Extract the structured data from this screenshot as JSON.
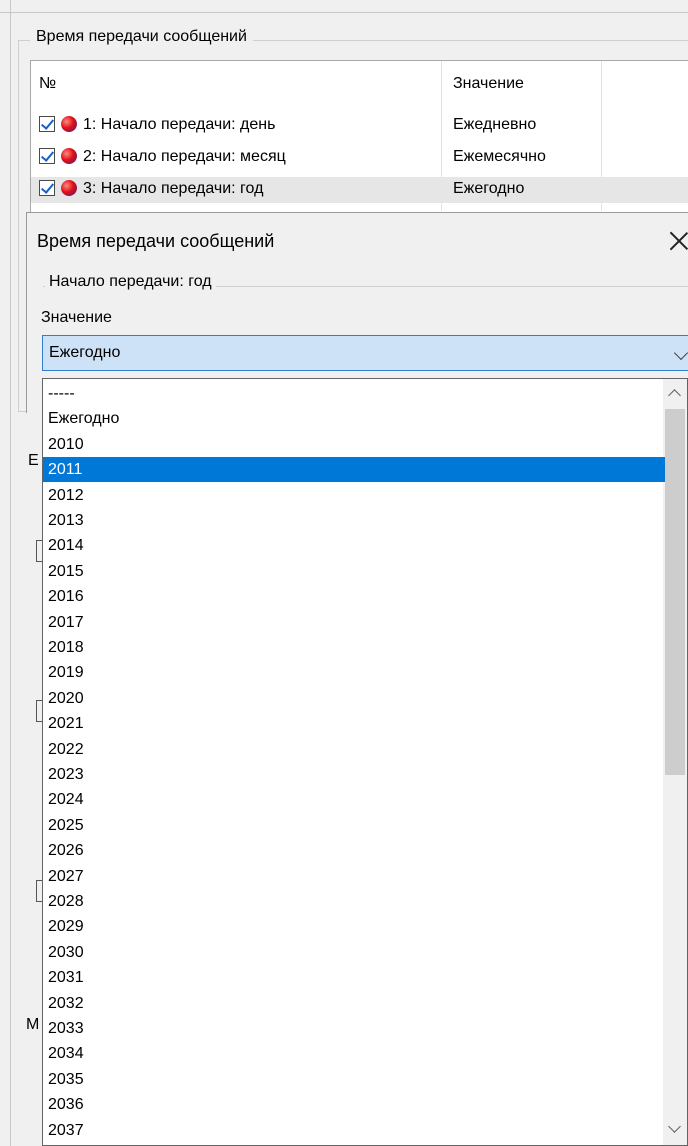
{
  "group": {
    "title": "Время передачи сообщений"
  },
  "table": {
    "col_no": "№",
    "col_value": "Значение",
    "rows": [
      {
        "label": "1: Начало передачи: день",
        "value": "Ежедневно",
        "checked": true
      },
      {
        "label": "2: Начало передачи: месяц",
        "value": "Ежемесячно",
        "checked": true
      },
      {
        "label": "3: Начало передачи: год",
        "value": "Ежегодно",
        "checked": true
      }
    ]
  },
  "background": {
    "letter_b": "Е",
    "letter_m": "М"
  },
  "dialog": {
    "title": "Время передачи сообщений",
    "group_title": "Начало передачи: год",
    "field_label": "Значение",
    "selected_value": "Ежегодно"
  },
  "dropdown": {
    "highlighted": "2011",
    "options": [
      "-----",
      "Ежегодно",
      "2010",
      "2011",
      "2012",
      "2013",
      "2014",
      "2015",
      "2016",
      "2017",
      "2018",
      "2019",
      "2020",
      "2021",
      "2022",
      "2023",
      "2024",
      "2025",
      "2026",
      "2027",
      "2028",
      "2029",
      "2030",
      "2031",
      "2032",
      "2033",
      "2034",
      "2035",
      "2036",
      "2037"
    ]
  },
  "colors": {
    "selection": "#0078d7",
    "combo_bg": "#cde2f7",
    "combo_border": "#2f7fd0"
  }
}
